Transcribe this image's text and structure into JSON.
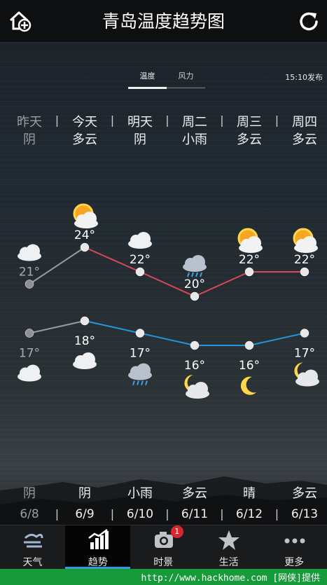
{
  "header": {
    "title": "青岛温度趋势图"
  },
  "view_tabs": [
    {
      "label": "温度",
      "active": true
    },
    {
      "label": "风力",
      "active": false
    }
  ],
  "published": "15:10发布",
  "days": [
    {
      "name": "昨天",
      "weather": "阴",
      "dim": true
    },
    {
      "name": "今天",
      "weather": "多云",
      "dim": false
    },
    {
      "name": "明天",
      "weather": "阴",
      "dim": false
    },
    {
      "name": "周二",
      "weather": "小雨",
      "dim": false
    },
    {
      "name": "周三",
      "weather": "多云",
      "dim": false
    },
    {
      "name": "周四",
      "weather": "多云",
      "dim": false
    }
  ],
  "bottom": [
    {
      "weather": "阴",
      "date": "6/8",
      "dim": true
    },
    {
      "weather": "阴",
      "date": "6/9",
      "dim": false
    },
    {
      "weather": "小雨",
      "date": "6/10",
      "dim": false
    },
    {
      "weather": "多云",
      "date": "6/11",
      "dim": false
    },
    {
      "weather": "晴",
      "date": "6/12",
      "dim": false
    },
    {
      "weather": "多云",
      "date": "6/13",
      "dim": false
    }
  ],
  "separator": "|",
  "chart_data": {
    "type": "line",
    "x": [
      "6/8",
      "6/9",
      "6/10",
      "6/11",
      "6/12",
      "6/13"
    ],
    "series": [
      {
        "values": [
          21,
          24,
          22,
          20,
          22,
          22
        ],
        "labels": [
          "21°",
          "24°",
          "22°",
          "20°",
          "22°",
          "22°"
        ],
        "color": "#d9485a",
        "icons": [
          "cloud",
          "sun-cloud",
          "cloud",
          "rain-cloud",
          "sun-cloud",
          "sun-cloud"
        ]
      },
      {
        "values": [
          17,
          18,
          17,
          16,
          16,
          17
        ],
        "labels": [
          "17°",
          "18°",
          "17°",
          "16°",
          "16°",
          "17°"
        ],
        "color": "#2196d8",
        "icons": [
          "cloud",
          "cloud",
          "rain-cloud",
          "moon-cloud",
          "moon",
          "moon-cloud"
        ]
      }
    ],
    "past_color": "#9a9a9a",
    "ylim": [
      14,
      26
    ]
  },
  "nav": [
    {
      "label": "天气",
      "icon": "wind-cloud-icon",
      "active": false
    },
    {
      "label": "趋势",
      "icon": "bar-chart-icon",
      "active": true
    },
    {
      "label": "时景",
      "icon": "camera-icon",
      "active": false,
      "badge": "1"
    },
    {
      "label": "生活",
      "icon": "star-icon",
      "active": false
    },
    {
      "label": "更多",
      "icon": "more-icon",
      "active": false
    }
  ],
  "footer": "http://www.hackhome.com [网侠]提供"
}
